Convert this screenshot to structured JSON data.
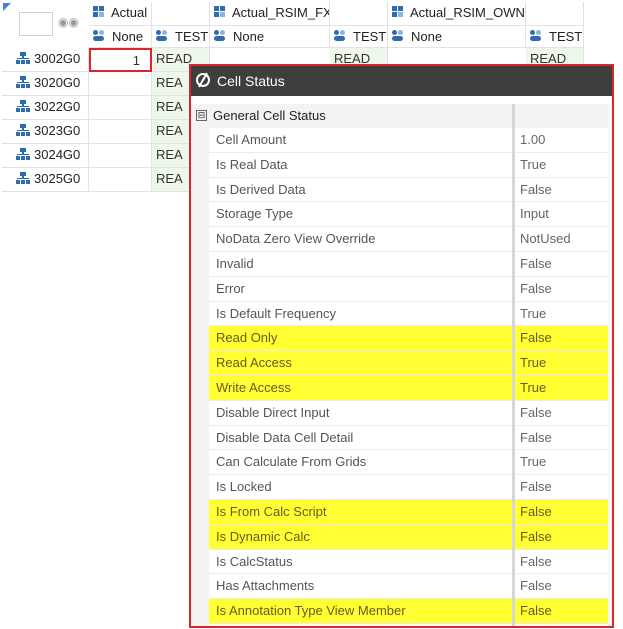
{
  "grid": {
    "columns": [
      {
        "scenario": "Actual",
        "member": "None"
      },
      {
        "scenario": "",
        "member": "TEST"
      },
      {
        "scenario": "Actual_RSIM_FX",
        "member": "None"
      },
      {
        "scenario": "",
        "member": "TEST"
      },
      {
        "scenario": "Actual_RSIM_OWN",
        "member": "None"
      },
      {
        "scenario": "",
        "member": "TEST"
      }
    ],
    "rows": [
      {
        "label": "3002G0",
        "c0": "1",
        "c1": "READ",
        "c3": "READ",
        "c5": "READ"
      },
      {
        "label": "3020G0",
        "c1": "REA"
      },
      {
        "label": "3022G0",
        "c1": "REA"
      },
      {
        "label": "3023G0",
        "c1": "REA"
      },
      {
        "label": "3024G0",
        "c1": "REA"
      },
      {
        "label": "3025G0",
        "c1": "REA"
      }
    ]
  },
  "dialog": {
    "title": "Cell Status",
    "category": "General Cell Status",
    "collapse_symbol": "⊟",
    "highlight_color": "#ffff33",
    "properties": [
      {
        "name": "Cell Amount",
        "value": "1.00",
        "highlight": false
      },
      {
        "name": "Is Real Data",
        "value": "True",
        "highlight": false
      },
      {
        "name": "Is Derived Data",
        "value": "False",
        "highlight": false
      },
      {
        "name": "Storage Type",
        "value": "Input",
        "highlight": false
      },
      {
        "name": "NoData Zero View Override",
        "value": "NotUsed",
        "highlight": false
      },
      {
        "name": "Invalid",
        "value": "False",
        "highlight": false
      },
      {
        "name": "Error",
        "value": "False",
        "highlight": false
      },
      {
        "name": "Is Default Frequency",
        "value": "True",
        "highlight": false
      },
      {
        "name": "Read Only",
        "value": "False",
        "highlight": true
      },
      {
        "name": "Read Access",
        "value": "True",
        "highlight": true
      },
      {
        "name": "Write Access",
        "value": "True",
        "highlight": true
      },
      {
        "name": "Disable Direct Input",
        "value": "False",
        "highlight": false
      },
      {
        "name": "Disable Data Cell Detail",
        "value": "False",
        "highlight": false
      },
      {
        "name": "Can Calculate From Grids",
        "value": "True",
        "highlight": false
      },
      {
        "name": "Is Locked",
        "value": "False",
        "highlight": false
      },
      {
        "name": "Is From Calc Script",
        "value": "False",
        "highlight": true
      },
      {
        "name": "Is Dynamic Calc",
        "value": "False",
        "highlight": true
      },
      {
        "name": "Is CalcStatus",
        "value": "False",
        "highlight": false
      },
      {
        "name": "Has Attachments",
        "value": "False",
        "highlight": false
      },
      {
        "name": "Is Annotation Type View Member",
        "value": "False",
        "highlight": true
      }
    ]
  }
}
